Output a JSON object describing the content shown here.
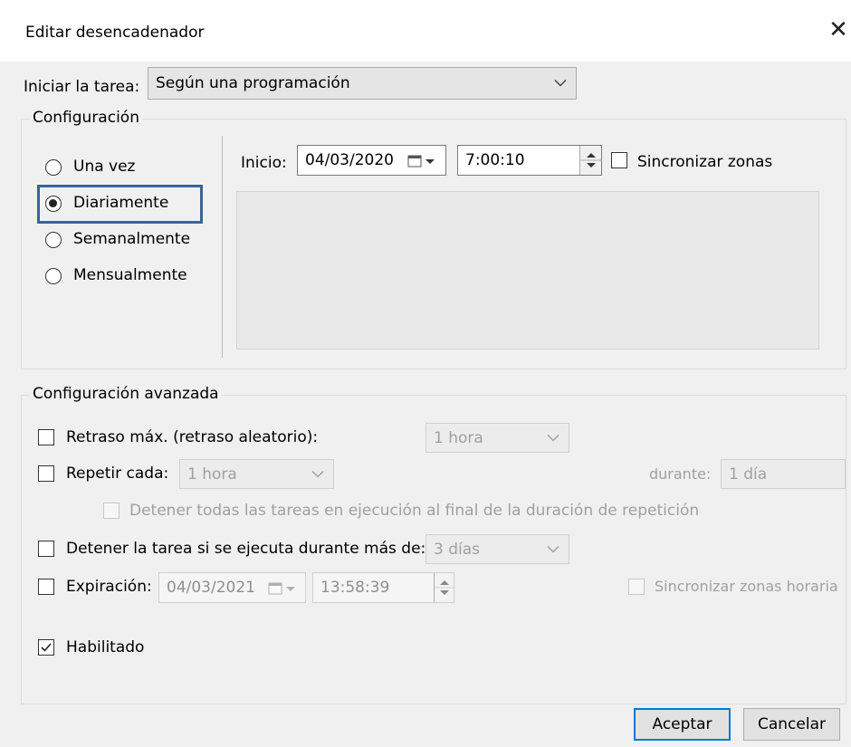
{
  "dialog": {
    "title": "Editar desencadenador",
    "close_glyph": "✕"
  },
  "start_task": {
    "label": "Iniciar la tarea:",
    "value": "Según una programación"
  },
  "config": {
    "legend": "Configuración",
    "options": [
      {
        "label": "Una vez",
        "selected": false
      },
      {
        "label": "Diariamente",
        "selected": true
      },
      {
        "label": "Semanalmente",
        "selected": false
      },
      {
        "label": "Mensualmente",
        "selected": false
      }
    ],
    "start_label": "Inicio:",
    "start_date": "04/03/2020",
    "start_time": "7:00:10",
    "sync_label": "Sincronizar zonas",
    "highlight_color": "#3a6496"
  },
  "advanced": {
    "legend": "Configuración avanzada",
    "max_delay": {
      "label": "Retraso máx. (retraso aleatorio):",
      "value": "1 hora",
      "checked": false
    },
    "repeat": {
      "label": "Repetir cada:",
      "value": "1 hora",
      "duration_label": "durante:",
      "duration_value": "1 día",
      "checked": false
    },
    "stop_all": {
      "label": "Detener todas las tareas en ejecución al final de la duración de repetición",
      "checked": false
    },
    "stop_if": {
      "label": "Detener la tarea si se ejecuta durante más de:",
      "value": "3 días",
      "checked": false
    },
    "expiration": {
      "label": "Expiración:",
      "date": "04/03/2021",
      "time": "13:58:39",
      "checked": false
    },
    "sync_tz": {
      "label": "Sincronizar zonas horaria",
      "checked": false
    },
    "enabled": {
      "label": "Habilitado",
      "checked": true
    }
  },
  "buttons": {
    "accept": "Aceptar",
    "cancel": "Cancelar"
  },
  "colors": {
    "accent": "#0078d7",
    "disabled_text": "#a0a0a0"
  }
}
